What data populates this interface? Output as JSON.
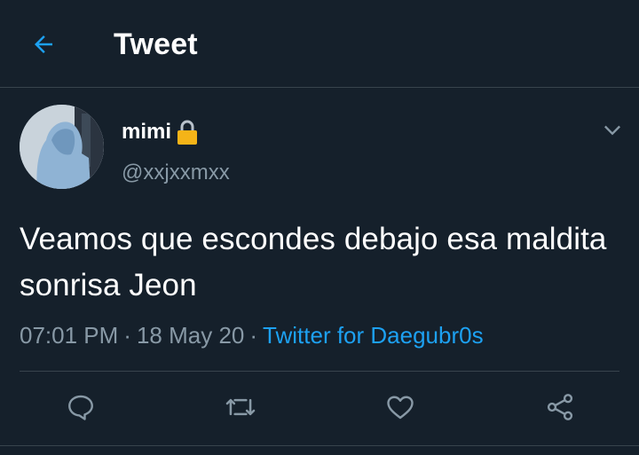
{
  "header": {
    "title": "Tweet",
    "back_icon": "arrow-left-icon"
  },
  "tweet": {
    "display_name": "mimi",
    "lock_icon": "lock-icon",
    "handle": "@xxjxxmxx",
    "text": "Veamos que escondes debajo esa maldita sonrisa Jeon",
    "time": "07:01 PM",
    "date": "18 May 20",
    "separator": "·",
    "source": "Twitter for Daegubr0s"
  },
  "actions": [
    "reply-icon",
    "retweet-icon",
    "like-icon",
    "share-icon"
  ],
  "colors": {
    "background": "#15202b",
    "accent": "#1da1f2",
    "muted": "#8899a6",
    "border": "#38444d"
  }
}
